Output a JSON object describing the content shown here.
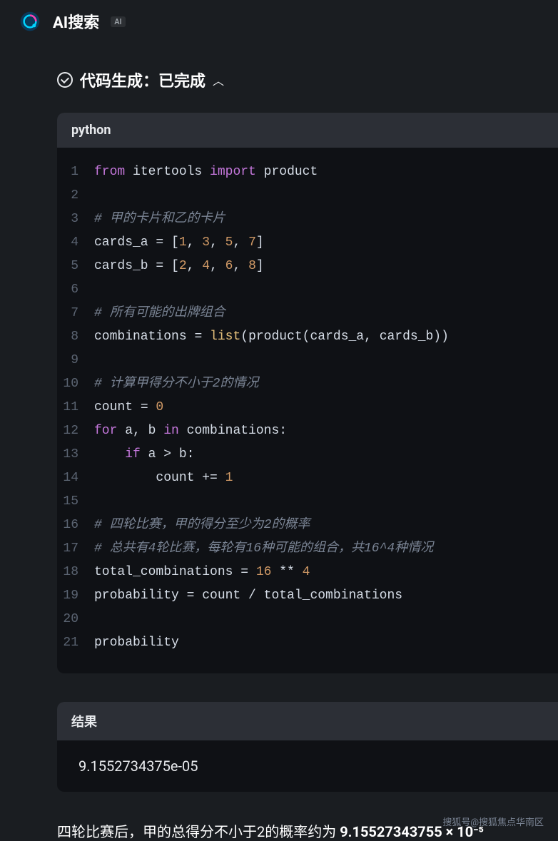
{
  "header": {
    "title": "AI搜索",
    "badge": "AI"
  },
  "section": {
    "title": "代码生成：已完成",
    "chevron": "︿"
  },
  "code": {
    "language": "python",
    "lines": [
      {
        "n": "1",
        "tokens": [
          [
            "kw-from",
            "from "
          ],
          [
            "ident",
            "itertools "
          ],
          [
            "kw-import",
            "import "
          ],
          [
            "ident",
            "product"
          ]
        ]
      },
      {
        "n": "2",
        "tokens": []
      },
      {
        "n": "3",
        "tokens": [
          [
            "comment",
            "# 甲的卡片和乙的卡片"
          ]
        ]
      },
      {
        "n": "4",
        "tokens": [
          [
            "ident",
            "cards_a "
          ],
          [
            "op",
            "= ["
          ],
          [
            "num",
            "1"
          ],
          [
            "op",
            ", "
          ],
          [
            "num",
            "3"
          ],
          [
            "op",
            ", "
          ],
          [
            "num",
            "5"
          ],
          [
            "op",
            ", "
          ],
          [
            "num",
            "7"
          ],
          [
            "op",
            "]"
          ]
        ]
      },
      {
        "n": "5",
        "tokens": [
          [
            "ident",
            "cards_b "
          ],
          [
            "op",
            "= ["
          ],
          [
            "num",
            "2"
          ],
          [
            "op",
            ", "
          ],
          [
            "num",
            "4"
          ],
          [
            "op",
            ", "
          ],
          [
            "num",
            "6"
          ],
          [
            "op",
            ", "
          ],
          [
            "num",
            "8"
          ],
          [
            "op",
            "]"
          ]
        ]
      },
      {
        "n": "6",
        "tokens": []
      },
      {
        "n": "7",
        "tokens": [
          [
            "comment",
            "# 所有可能的出牌组合"
          ]
        ]
      },
      {
        "n": "8",
        "tokens": [
          [
            "ident",
            "combinations "
          ],
          [
            "op",
            "= "
          ],
          [
            "builtin",
            "list"
          ],
          [
            "op",
            "(product(cards_a, cards_b))"
          ]
        ]
      },
      {
        "n": "9",
        "tokens": []
      },
      {
        "n": "10",
        "tokens": [
          [
            "comment",
            "# 计算甲得分不小于2的情况"
          ]
        ]
      },
      {
        "n": "11",
        "tokens": [
          [
            "ident",
            "count "
          ],
          [
            "op",
            "= "
          ],
          [
            "num",
            "0"
          ]
        ]
      },
      {
        "n": "12",
        "tokens": [
          [
            "kw-for",
            "for "
          ],
          [
            "ident",
            "a, b "
          ],
          [
            "kw-in",
            "in "
          ],
          [
            "ident",
            "combinations:"
          ]
        ]
      },
      {
        "n": "13",
        "tokens": [
          [
            "ident",
            "    "
          ],
          [
            "kw-if",
            "if "
          ],
          [
            "ident",
            "a > b:"
          ]
        ]
      },
      {
        "n": "14",
        "tokens": [
          [
            "ident",
            "        count "
          ],
          [
            "op",
            "+= "
          ],
          [
            "num",
            "1"
          ]
        ]
      },
      {
        "n": "15",
        "tokens": []
      },
      {
        "n": "16",
        "tokens": [
          [
            "comment",
            "# 四轮比赛，甲的得分至少为2的概率"
          ]
        ]
      },
      {
        "n": "17",
        "tokens": [
          [
            "comment",
            "# 总共有4轮比赛，每轮有16种可能的组合，共16^4种情况"
          ]
        ]
      },
      {
        "n": "18",
        "tokens": [
          [
            "ident",
            "total_combinations "
          ],
          [
            "op",
            "= "
          ],
          [
            "num",
            "16"
          ],
          [
            "op",
            " ** "
          ],
          [
            "num",
            "4"
          ]
        ]
      },
      {
        "n": "19",
        "tokens": [
          [
            "ident",
            "probability "
          ],
          [
            "op",
            "= count / total_combinations"
          ]
        ]
      },
      {
        "n": "20",
        "tokens": []
      },
      {
        "n": "21",
        "tokens": [
          [
            "ident",
            "probability"
          ]
        ]
      }
    ]
  },
  "result": {
    "header": "结果",
    "value": "9.1552734375e-05"
  },
  "summary": {
    "prefix": "四轮比赛后，甲的总得分不小于2的概率约为 ",
    "value": "9.15527343755 × 10⁻⁵"
  },
  "watermark": "搜狐号@搜狐焦点华南区"
}
